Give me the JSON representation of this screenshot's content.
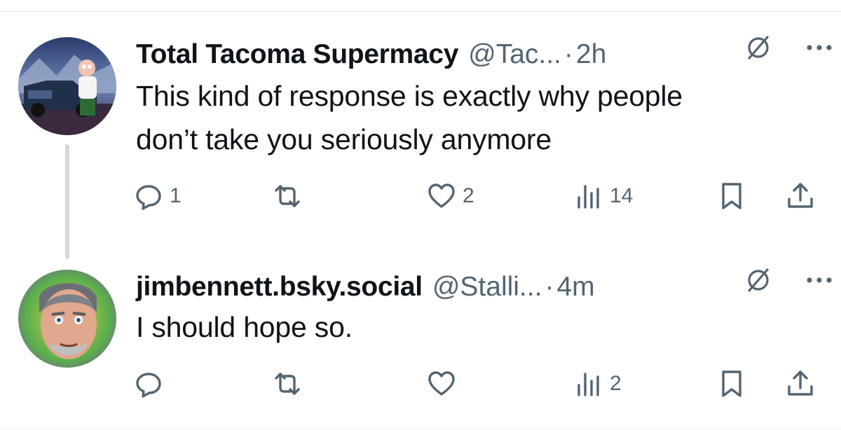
{
  "posts": [
    {
      "author": {
        "display_name": "Total Tacoma Supermacy",
        "handle": "@Tac...",
        "avatar_icon": "avatar-truck-cartoon"
      },
      "separator": "·",
      "time": "2h",
      "text_lines": [
        "This kind of response is exactly why people",
        "don’t take you seriously anymore"
      ],
      "actions": {
        "replies": "1",
        "reposts": "",
        "likes": "2",
        "views": "14"
      }
    },
    {
      "author": {
        "display_name": "jimbennett.bsky.social",
        "handle": "@Stalli...",
        "avatar_icon": "avatar-portrait-illustration"
      },
      "separator": "·",
      "time": "4m",
      "text_lines": [
        "I should hope so."
      ],
      "actions": {
        "replies": "",
        "reposts": "",
        "likes": "",
        "views": "2"
      }
    }
  ],
  "icons": {
    "reply": "reply-icon",
    "repost": "repost-icon",
    "like": "heart-icon",
    "views": "views-icon",
    "bookmark": "bookmark-icon",
    "share": "share-icon",
    "grok": "grok-icon",
    "more": "more-icon"
  },
  "colors": {
    "text_primary": "#0f1419",
    "text_secondary": "#536471",
    "thread_line": "#cfd9de",
    "divider": "#e6e8eb"
  }
}
